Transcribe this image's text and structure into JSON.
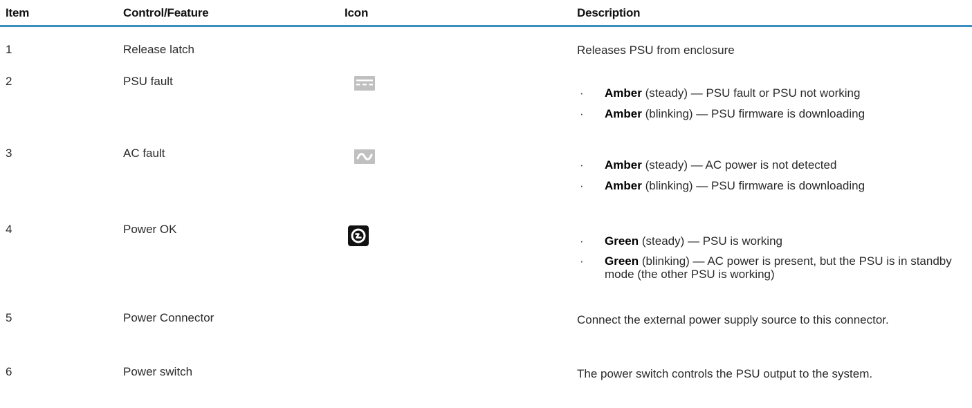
{
  "headers": {
    "item": "Item",
    "control": "Control/Feature",
    "icon": "Icon",
    "description": "Description"
  },
  "rows": [
    {
      "item": "1",
      "control": "Release latch",
      "icon": "",
      "description": "Releases PSU from enclosure"
    },
    {
      "item": "2",
      "control": "PSU fault",
      "icon": "psu-fault-icon",
      "bullets": [
        {
          "color": "Amber",
          "rest": " (steady) — PSU fault or PSU not working"
        },
        {
          "color": "Amber",
          "rest": " (blinking) — PSU firmware is downloading"
        }
      ]
    },
    {
      "item": "3",
      "control": "AC fault",
      "icon": "ac-fault-icon",
      "bullets": [
        {
          "color": "Amber",
          "rest": " (steady) — AC power is not detected"
        },
        {
          "color": "Amber",
          "rest": " (blinking) — PSU firmware is downloading"
        }
      ]
    },
    {
      "item": "4",
      "control": "Power OK",
      "icon": "power-ok-icon",
      "bullets": [
        {
          "color": "Green",
          "rest": " (steady) — PSU is working"
        },
        {
          "color": "Green",
          "rest": " (blinking) — AC power is present, but the PSU is in standby mode (the other PSU is working)"
        }
      ]
    },
    {
      "item": "5",
      "control": "Power Connector",
      "icon": "",
      "description": "Connect the external power supply source to this connector."
    },
    {
      "item": "6",
      "control": "Power switch",
      "icon": "",
      "description": "The power switch controls the PSU output to the system."
    }
  ],
  "bullet_glyph": "·"
}
